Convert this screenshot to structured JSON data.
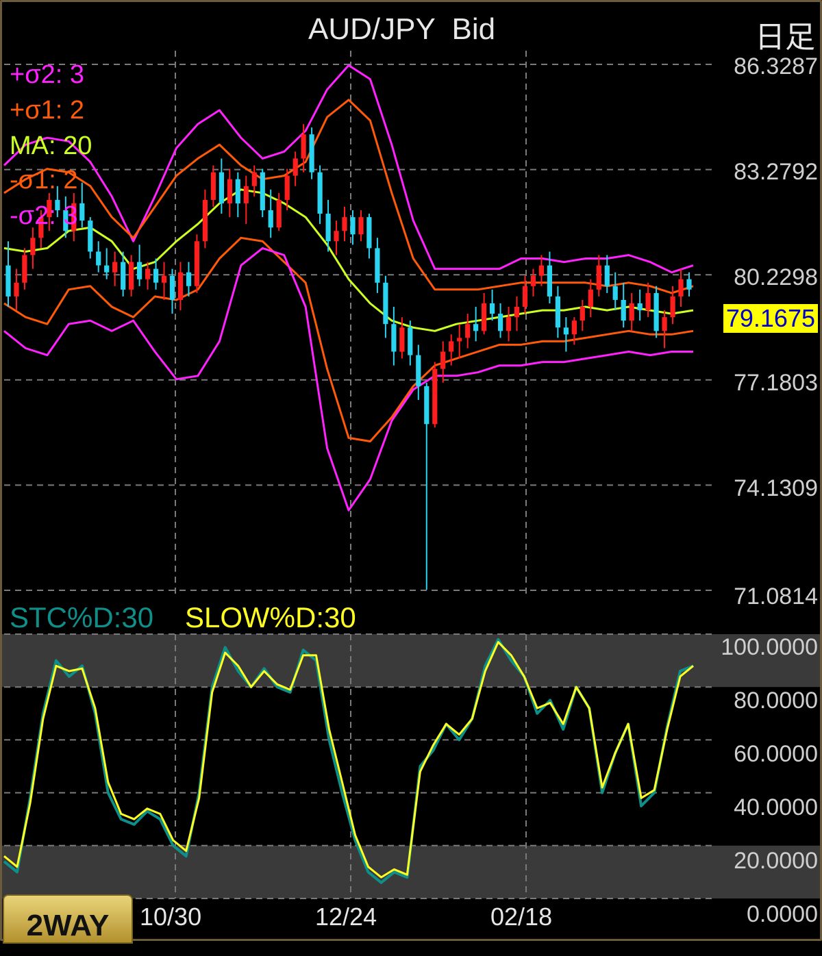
{
  "header": {
    "title": "AUD/JPY  Bid",
    "period": "日足"
  },
  "legend": {
    "plus_sigma2": "+σ2: 3",
    "plus_sigma1": "+σ1: 2",
    "ma": "MA: 20",
    "minus_sigma1": "-σ1: 2",
    "minus_sigma2": "-σ2: 3"
  },
  "current_price": "79.1675",
  "oscillator_labels": {
    "stc": "STC%D:30",
    "slow": "SLOW%D:30"
  },
  "button": {
    "label": "2WAY"
  },
  "colors": {
    "background": "#000000",
    "sigma2": "#ff22ff",
    "sigma1": "#ff5a0a",
    "ma": "#ccff22",
    "candle_up": "#ff1e1e",
    "candle_down": "#2ad4f0",
    "stc": "#0f8f8a",
    "slow": "#ffff22",
    "price_tag": "#ffff00"
  },
  "chart_data": [
    {
      "type": "candlestick",
      "title": "AUD/JPY  Bid",
      "y_ticks": [
        "86.3287",
        "83.2792",
        "80.2298",
        "77.1803",
        "74.1309",
        "71.0814"
      ],
      "ylim": [
        71.0814,
        86.3287
      ],
      "x_ticks": [
        "10/30",
        "12/24",
        "02/18"
      ],
      "grid": true,
      "last_price": 79.1675,
      "overlays": [
        {
          "name": "+σ2: 3",
          "color": "#ff22ff",
          "values": [
            83.4,
            84.0,
            84.2,
            84.1,
            83.5,
            82.5,
            81.2,
            82.5,
            83.9,
            84.6,
            85.0,
            84.2,
            83.6,
            83.8,
            84.4,
            85.6,
            86.3,
            85.9,
            84.0,
            81.8,
            80.4,
            80.4,
            80.4,
            80.4,
            80.7,
            80.7,
            80.6,
            80.7,
            80.7,
            80.8,
            80.6,
            80.3,
            80.5
          ]
        },
        {
          "name": "+σ1: 2",
          "color": "#ff5a0a",
          "values": [
            82.6,
            83.0,
            83.3,
            83.2,
            82.8,
            81.9,
            81.3,
            82.2,
            83.1,
            83.6,
            84.0,
            83.4,
            83.0,
            83.1,
            83.5,
            84.8,
            85.3,
            84.7,
            82.6,
            80.7,
            79.8,
            79.8,
            79.8,
            79.9,
            80.0,
            80.0,
            80.0,
            80.0,
            79.9,
            80.0,
            79.9,
            79.7,
            79.9
          ]
        },
        {
          "name": "MA: 20",
          "color": "#ccff22",
          "values": [
            81.0,
            80.9,
            81.0,
            81.5,
            81.6,
            81.2,
            80.4,
            80.6,
            81.2,
            81.7,
            82.3,
            82.7,
            82.6,
            82.3,
            81.9,
            81.1,
            80.1,
            79.4,
            78.9,
            78.7,
            78.6,
            78.8,
            78.9,
            79.0,
            79.1,
            79.2,
            79.2,
            79.3,
            79.2,
            79.3,
            79.2,
            79.1,
            79.2
          ]
        },
        {
          "name": "-σ1: 2",
          "color": "#ff5a0a",
          "values": [
            79.4,
            79.0,
            78.8,
            79.8,
            79.9,
            79.3,
            79.0,
            79.6,
            79.5,
            79.8,
            80.7,
            81.3,
            81.2,
            80.6,
            80.0,
            77.5,
            75.5,
            75.4,
            76.1,
            77.0,
            77.6,
            77.8,
            78.0,
            78.2,
            78.2,
            78.3,
            78.3,
            78.4,
            78.5,
            78.6,
            78.5,
            78.5,
            78.6
          ]
        },
        {
          "name": "-σ2: 3",
          "color": "#ff22ff",
          "values": [
            78.6,
            78.1,
            77.9,
            78.8,
            78.9,
            78.6,
            78.9,
            78.0,
            77.2,
            77.3,
            78.3,
            80.5,
            81.0,
            80.8,
            79.3,
            75.2,
            73.4,
            74.3,
            76.0,
            76.9,
            77.3,
            77.3,
            77.4,
            77.6,
            77.6,
            77.7,
            77.7,
            77.8,
            77.9,
            78.0,
            77.9,
            78.0,
            78.0
          ]
        }
      ],
      "candles": [
        {
          "o": 80.5,
          "h": 81.2,
          "l": 79.3,
          "c": 79.6
        },
        {
          "o": 79.6,
          "h": 80.4,
          "l": 79.2,
          "c": 80.0
        },
        {
          "o": 80.0,
          "h": 81.0,
          "l": 79.8,
          "c": 80.8
        },
        {
          "o": 80.8,
          "h": 81.6,
          "l": 80.4,
          "c": 81.3
        },
        {
          "o": 81.3,
          "h": 82.1,
          "l": 81.0,
          "c": 81.9
        },
        {
          "o": 81.9,
          "h": 82.6,
          "l": 81.5,
          "c": 82.4
        },
        {
          "o": 82.4,
          "h": 82.8,
          "l": 81.9,
          "c": 82.1
        },
        {
          "o": 82.1,
          "h": 82.5,
          "l": 81.3,
          "c": 81.5
        },
        {
          "o": 81.5,
          "h": 82.6,
          "l": 81.2,
          "c": 82.3
        },
        {
          "o": 82.3,
          "h": 82.9,
          "l": 81.6,
          "c": 81.8
        },
        {
          "o": 81.8,
          "h": 81.9,
          "l": 80.7,
          "c": 80.9
        },
        {
          "o": 80.9,
          "h": 81.2,
          "l": 80.3,
          "c": 80.5
        },
        {
          "o": 80.5,
          "h": 81.0,
          "l": 80.1,
          "c": 80.3
        },
        {
          "o": 80.3,
          "h": 80.9,
          "l": 79.9,
          "c": 80.6
        },
        {
          "o": 80.6,
          "h": 80.9,
          "l": 79.6,
          "c": 79.8
        },
        {
          "o": 79.8,
          "h": 80.8,
          "l": 79.6,
          "c": 80.6
        },
        {
          "o": 80.6,
          "h": 81.1,
          "l": 79.9,
          "c": 80.1
        },
        {
          "o": 80.1,
          "h": 80.6,
          "l": 79.8,
          "c": 80.4
        },
        {
          "o": 80.4,
          "h": 80.7,
          "l": 79.8,
          "c": 80.0
        },
        {
          "o": 80.0,
          "h": 80.6,
          "l": 79.5,
          "c": 80.2
        },
        {
          "o": 80.2,
          "h": 80.4,
          "l": 79.1,
          "c": 79.5
        },
        {
          "o": 79.5,
          "h": 80.6,
          "l": 79.2,
          "c": 80.3
        },
        {
          "o": 80.3,
          "h": 80.6,
          "l": 79.6,
          "c": 79.9
        },
        {
          "o": 79.9,
          "h": 81.4,
          "l": 79.7,
          "c": 81.2
        },
        {
          "o": 81.2,
          "h": 82.7,
          "l": 81.0,
          "c": 82.4
        },
        {
          "o": 82.4,
          "h": 83.4,
          "l": 82.2,
          "c": 83.2
        },
        {
          "o": 83.2,
          "h": 83.6,
          "l": 82.0,
          "c": 82.3
        },
        {
          "o": 82.3,
          "h": 83.3,
          "l": 81.9,
          "c": 83.0
        },
        {
          "o": 83.0,
          "h": 83.2,
          "l": 81.9,
          "c": 82.3
        },
        {
          "o": 82.3,
          "h": 83.1,
          "l": 81.7,
          "c": 82.8
        },
        {
          "o": 82.8,
          "h": 83.4,
          "l": 82.5,
          "c": 83.2
        },
        {
          "o": 83.2,
          "h": 83.3,
          "l": 81.9,
          "c": 82.1
        },
        {
          "o": 82.1,
          "h": 82.7,
          "l": 81.3,
          "c": 81.6
        },
        {
          "o": 81.6,
          "h": 82.6,
          "l": 81.5,
          "c": 82.4
        },
        {
          "o": 82.4,
          "h": 83.3,
          "l": 82.1,
          "c": 83.1
        },
        {
          "o": 83.1,
          "h": 83.8,
          "l": 82.8,
          "c": 83.6
        },
        {
          "o": 83.6,
          "h": 84.6,
          "l": 83.2,
          "c": 84.3
        },
        {
          "o": 84.3,
          "h": 84.5,
          "l": 83.0,
          "c": 83.2
        },
        {
          "o": 83.2,
          "h": 83.4,
          "l": 81.7,
          "c": 82.0
        },
        {
          "o": 82.0,
          "h": 82.4,
          "l": 80.9,
          "c": 81.2
        },
        {
          "o": 81.2,
          "h": 81.8,
          "l": 80.8,
          "c": 81.5
        },
        {
          "o": 81.5,
          "h": 82.2,
          "l": 81.2,
          "c": 81.9
        },
        {
          "o": 81.9,
          "h": 82.1,
          "l": 81.1,
          "c": 81.4
        },
        {
          "o": 81.4,
          "h": 82.1,
          "l": 81.2,
          "c": 81.9
        },
        {
          "o": 81.9,
          "h": 82.0,
          "l": 80.7,
          "c": 81.0
        },
        {
          "o": 81.0,
          "h": 81.3,
          "l": 79.7,
          "c": 80.0
        },
        {
          "o": 80.0,
          "h": 80.2,
          "l": 78.4,
          "c": 78.8
        },
        {
          "o": 78.8,
          "h": 79.3,
          "l": 77.6,
          "c": 78.0
        },
        {
          "o": 78.0,
          "h": 79.0,
          "l": 77.8,
          "c": 78.7
        },
        {
          "o": 78.7,
          "h": 78.9,
          "l": 77.6,
          "c": 77.9
        },
        {
          "o": 77.9,
          "h": 78.2,
          "l": 76.6,
          "c": 77.0
        },
        {
          "o": 77.0,
          "h": 77.1,
          "l": 71.1,
          "c": 75.9
        },
        {
          "o": 75.9,
          "h": 77.7,
          "l": 75.8,
          "c": 77.5
        },
        {
          "o": 77.5,
          "h": 78.3,
          "l": 77.1,
          "c": 78.0
        },
        {
          "o": 78.0,
          "h": 78.5,
          "l": 77.6,
          "c": 78.3
        },
        {
          "o": 78.3,
          "h": 78.8,
          "l": 77.8,
          "c": 78.4
        },
        {
          "o": 78.4,
          "h": 79.1,
          "l": 78.1,
          "c": 78.8
        },
        {
          "o": 78.8,
          "h": 79.3,
          "l": 78.3,
          "c": 78.6
        },
        {
          "o": 78.6,
          "h": 79.7,
          "l": 78.5,
          "c": 79.4
        },
        {
          "o": 79.4,
          "h": 79.8,
          "l": 78.9,
          "c": 79.1
        },
        {
          "o": 79.1,
          "h": 79.4,
          "l": 78.4,
          "c": 78.6
        },
        {
          "o": 78.6,
          "h": 79.3,
          "l": 78.3,
          "c": 79.0
        },
        {
          "o": 79.0,
          "h": 79.6,
          "l": 78.6,
          "c": 79.3
        },
        {
          "o": 79.3,
          "h": 80.2,
          "l": 79.1,
          "c": 79.9
        },
        {
          "o": 79.9,
          "h": 80.4,
          "l": 79.6,
          "c": 80.2
        },
        {
          "o": 80.2,
          "h": 80.8,
          "l": 79.9,
          "c": 80.5
        },
        {
          "o": 80.5,
          "h": 80.9,
          "l": 79.4,
          "c": 79.6
        },
        {
          "o": 79.6,
          "h": 79.9,
          "l": 78.4,
          "c": 78.7
        },
        {
          "o": 78.7,
          "h": 79.0,
          "l": 78.0,
          "c": 78.5
        },
        {
          "o": 78.5,
          "h": 79.0,
          "l": 78.2,
          "c": 78.9
        },
        {
          "o": 78.9,
          "h": 79.5,
          "l": 78.6,
          "c": 79.3
        },
        {
          "o": 79.3,
          "h": 80.1,
          "l": 79.0,
          "c": 79.8
        },
        {
          "o": 79.8,
          "h": 80.8,
          "l": 79.6,
          "c": 80.5
        },
        {
          "o": 80.5,
          "h": 80.8,
          "l": 79.7,
          "c": 79.9
        },
        {
          "o": 79.9,
          "h": 80.3,
          "l": 79.2,
          "c": 79.5
        },
        {
          "o": 79.5,
          "h": 80.0,
          "l": 78.7,
          "c": 78.9
        },
        {
          "o": 78.9,
          "h": 79.7,
          "l": 78.6,
          "c": 79.4
        },
        {
          "o": 79.4,
          "h": 79.8,
          "l": 78.9,
          "c": 79.2
        },
        {
          "o": 79.2,
          "h": 80.0,
          "l": 79.0,
          "c": 79.7
        },
        {
          "o": 79.7,
          "h": 79.9,
          "l": 78.4,
          "c": 78.6
        },
        {
          "o": 78.6,
          "h": 79.2,
          "l": 78.1,
          "c": 79.0
        },
        {
          "o": 79.0,
          "h": 79.9,
          "l": 78.8,
          "c": 79.6
        },
        {
          "o": 79.6,
          "h": 80.4,
          "l": 79.3,
          "c": 80.1
        },
        {
          "o": 80.1,
          "h": 80.3,
          "l": 79.6,
          "c": 79.8
        }
      ]
    },
    {
      "type": "line",
      "title": "",
      "y_ticks": [
        "100.0000",
        "80.0000",
        "60.0000",
        "40.0000",
        "20.0000",
        "0.0000"
      ],
      "ylim": [
        0,
        100
      ],
      "x_ticks": [
        "10/30",
        "12/24",
        "02/18"
      ],
      "series": [
        {
          "name": "STC%D:30",
          "color": "#0f8f8a",
          "values": [
            14,
            10,
            38,
            70,
            90,
            84,
            88,
            70,
            40,
            30,
            28,
            33,
            30,
            20,
            16,
            40,
            80,
            95,
            86,
            80,
            87,
            80,
            78,
            94,
            90,
            60,
            40,
            22,
            10,
            6,
            10,
            8,
            50,
            56,
            66,
            60,
            68,
            88,
            98,
            90,
            84,
            70,
            75,
            64,
            80,
            72,
            40,
            55,
            66,
            35,
            40,
            65,
            86,
            88
          ]
        },
        {
          "name": "SLOW%D:30",
          "color": "#ffff22",
          "values": [
            16,
            12,
            36,
            68,
            88,
            86,
            87,
            72,
            44,
            32,
            30,
            34,
            32,
            22,
            18,
            38,
            78,
            93,
            88,
            80,
            86,
            81,
            79,
            92,
            92,
            64,
            44,
            24,
            12,
            8,
            11,
            9,
            48,
            58,
            66,
            62,
            68,
            86,
            97,
            92,
            84,
            72,
            74,
            66,
            80,
            72,
            42,
            55,
            66,
            38,
            41,
            64,
            84,
            88
          ]
        }
      ],
      "bands": [
        "80.0000",
        "20.0000"
      ]
    }
  ]
}
